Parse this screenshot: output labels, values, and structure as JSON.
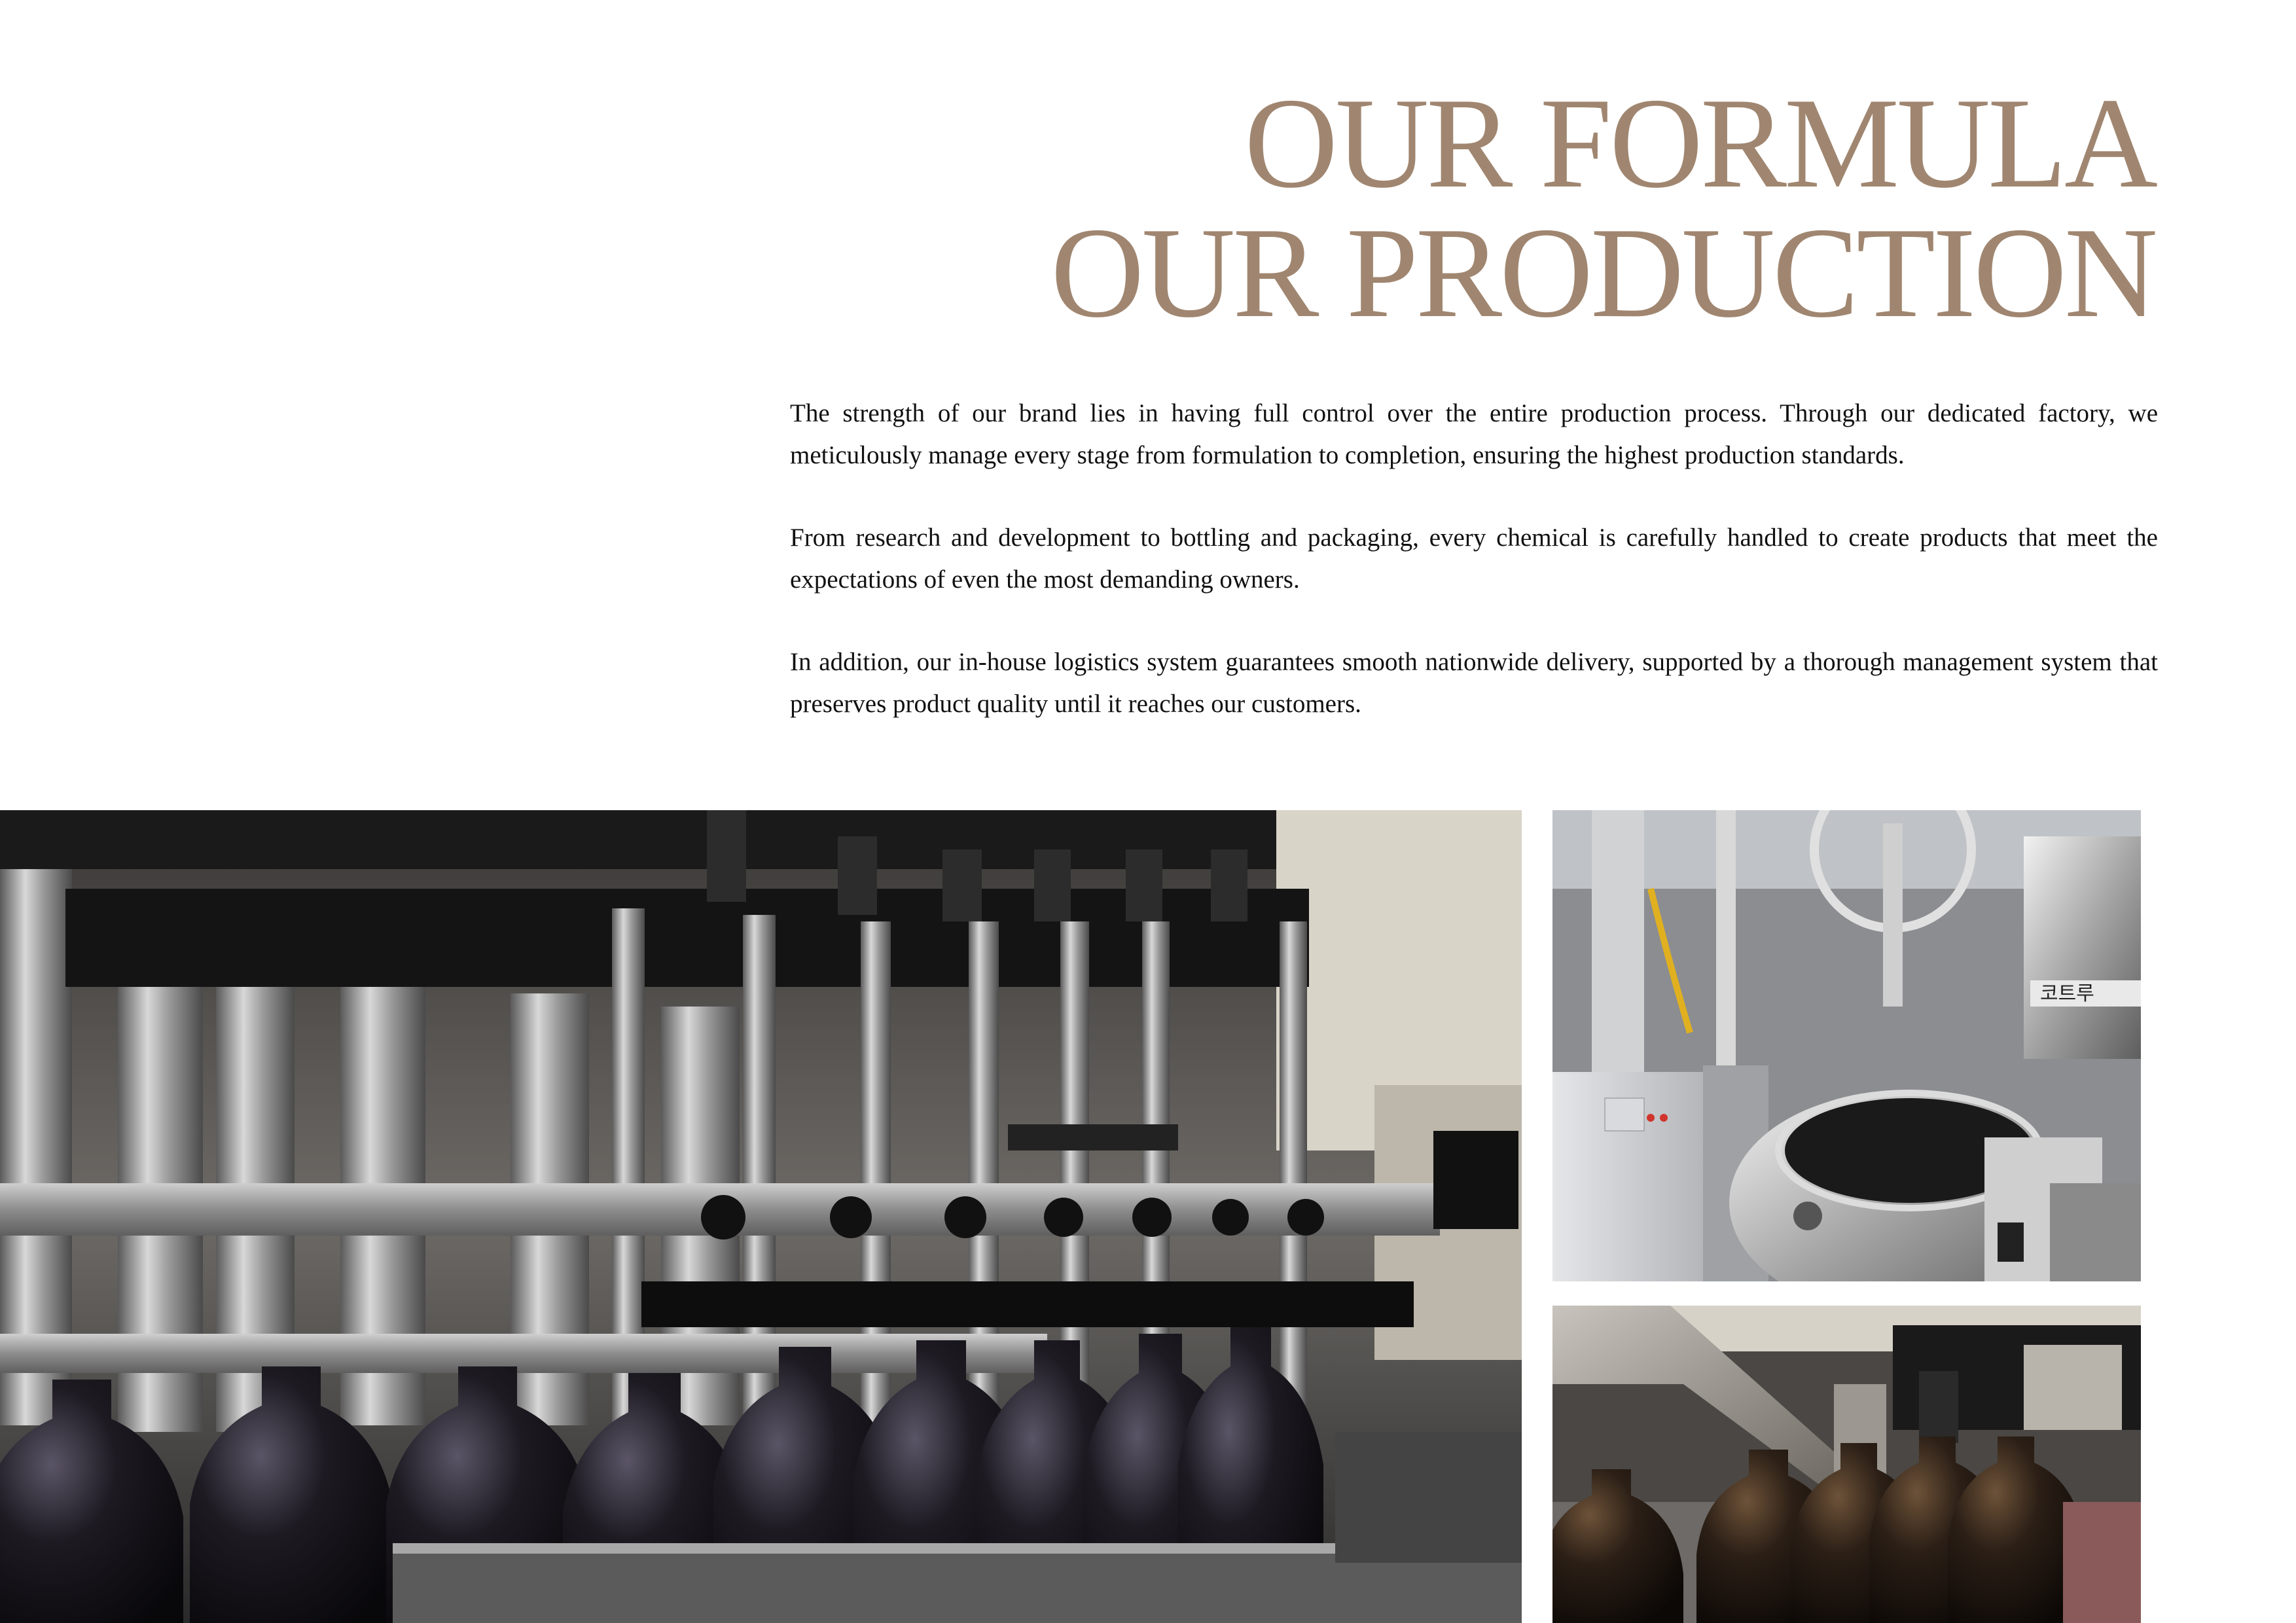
{
  "heading": {
    "line1": "OUR FORMULA",
    "line2": "OUR PRODUCTION",
    "color": "#a08670"
  },
  "paragraphs": [
    "The strength of our brand lies in having full control over the entire production process. Through our dedicated factory, we meticulously manage every stage from formulation to completion, ensuring the highest production standards.",
    "From research and development to bottling and packaging, every chemical is carefully handled to create products that meet the expectations of even the most demanding owners.",
    "In addition, our in-house logistics system guarantees smooth nationwide delivery, supported by a thorough management system that preserves product quality until it reaches our customers."
  ],
  "photos": {
    "main": "bottle-filling-line-photo",
    "tank": "mixing-tank-photo",
    "capper": "capping-machine-photo",
    "tank_label": "코트루"
  }
}
